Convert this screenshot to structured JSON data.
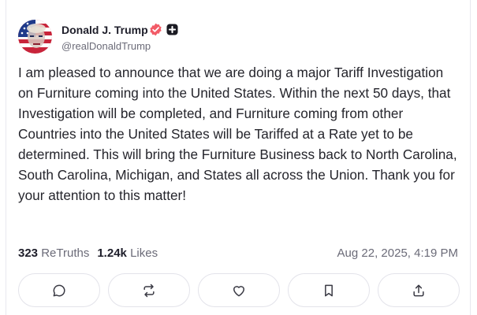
{
  "author": {
    "display_name": "Donald J. Trump",
    "handle": "@realDonaldTrump",
    "avatar": "flag-portrait-avatar",
    "badges": [
      "verified-badge-icon",
      "plus-badge-icon"
    ],
    "verified_color": "#f25b67"
  },
  "post": {
    "text": "I am pleased to announce that we are doing a major Tariff Investigation on Furniture coming into the United States. Within the next 50 days, that Investigation will be completed, and Furniture coming from other Countries into the United States will be Tariffed at a Rate yet to be determined. This will bring the Furniture Business back to North Carolina, South Carolina, Michigan, and States all across the Union. Thank you for your attention to this matter!"
  },
  "stats": {
    "retruths_count": "323",
    "retruths_label": "ReTruths",
    "likes_count": "1.24k",
    "likes_label": "Likes",
    "timestamp": "Aug 22, 2025, 4:19 PM"
  },
  "actions": [
    {
      "icon": "reply-icon"
    },
    {
      "icon": "retruth-icon"
    },
    {
      "icon": "like-icon"
    },
    {
      "icon": "bookmark-icon"
    },
    {
      "icon": "share-icon"
    }
  ],
  "colors": {
    "text": "#25252c",
    "muted": "#6b6b78",
    "border": "#e3e3ea"
  }
}
